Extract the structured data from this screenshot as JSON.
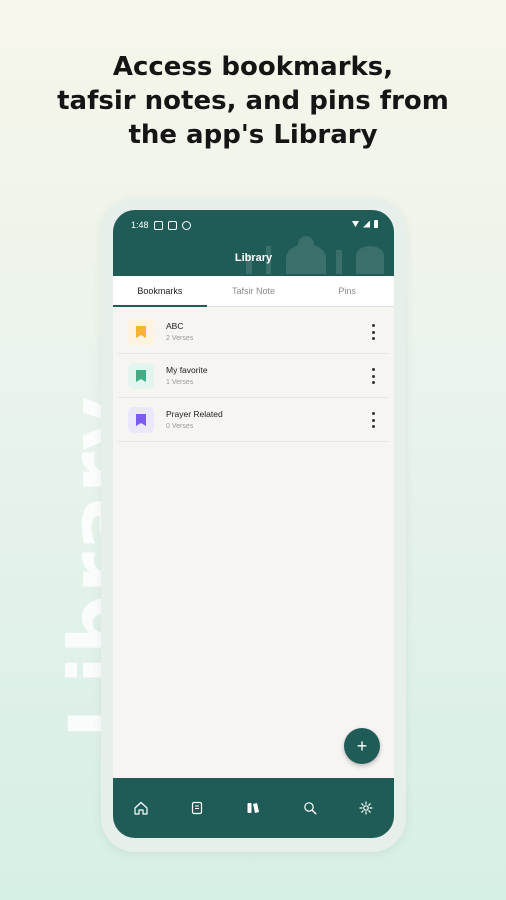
{
  "headline": "Access bookmarks,\ntafsir notes, and pins from\nthe app's Library",
  "side_word": "Library",
  "status_bar": {
    "time": "1:48"
  },
  "app": {
    "title": "Library"
  },
  "tabs": [
    {
      "label": "Bookmarks",
      "active": true
    },
    {
      "label": "Tafsir Note",
      "active": false
    },
    {
      "label": "Pins",
      "active": false
    }
  ],
  "bookmarks": [
    {
      "title": "ABC",
      "subtitle": "2 Verses",
      "icon": "bookmark-icon",
      "color": "#f4b333",
      "bg": "#fdf3df"
    },
    {
      "title": "My favorite",
      "subtitle": "1 Verses",
      "icon": "bookmark-icon",
      "color": "#3fae85",
      "bg": "#e4f4ee"
    },
    {
      "title": "Prayer Related",
      "subtitle": "0 Verses",
      "icon": "bookmark-icon",
      "color": "#7c5cf0",
      "bg": "#ece8fb"
    }
  ],
  "fab": {
    "label": "+"
  },
  "bottom_nav": [
    "home-icon",
    "quran-book-icon",
    "library-icon",
    "search-icon",
    "settings-icon"
  ],
  "colors": {
    "primary": "#1f5c58",
    "background": "#f6f5f2"
  }
}
